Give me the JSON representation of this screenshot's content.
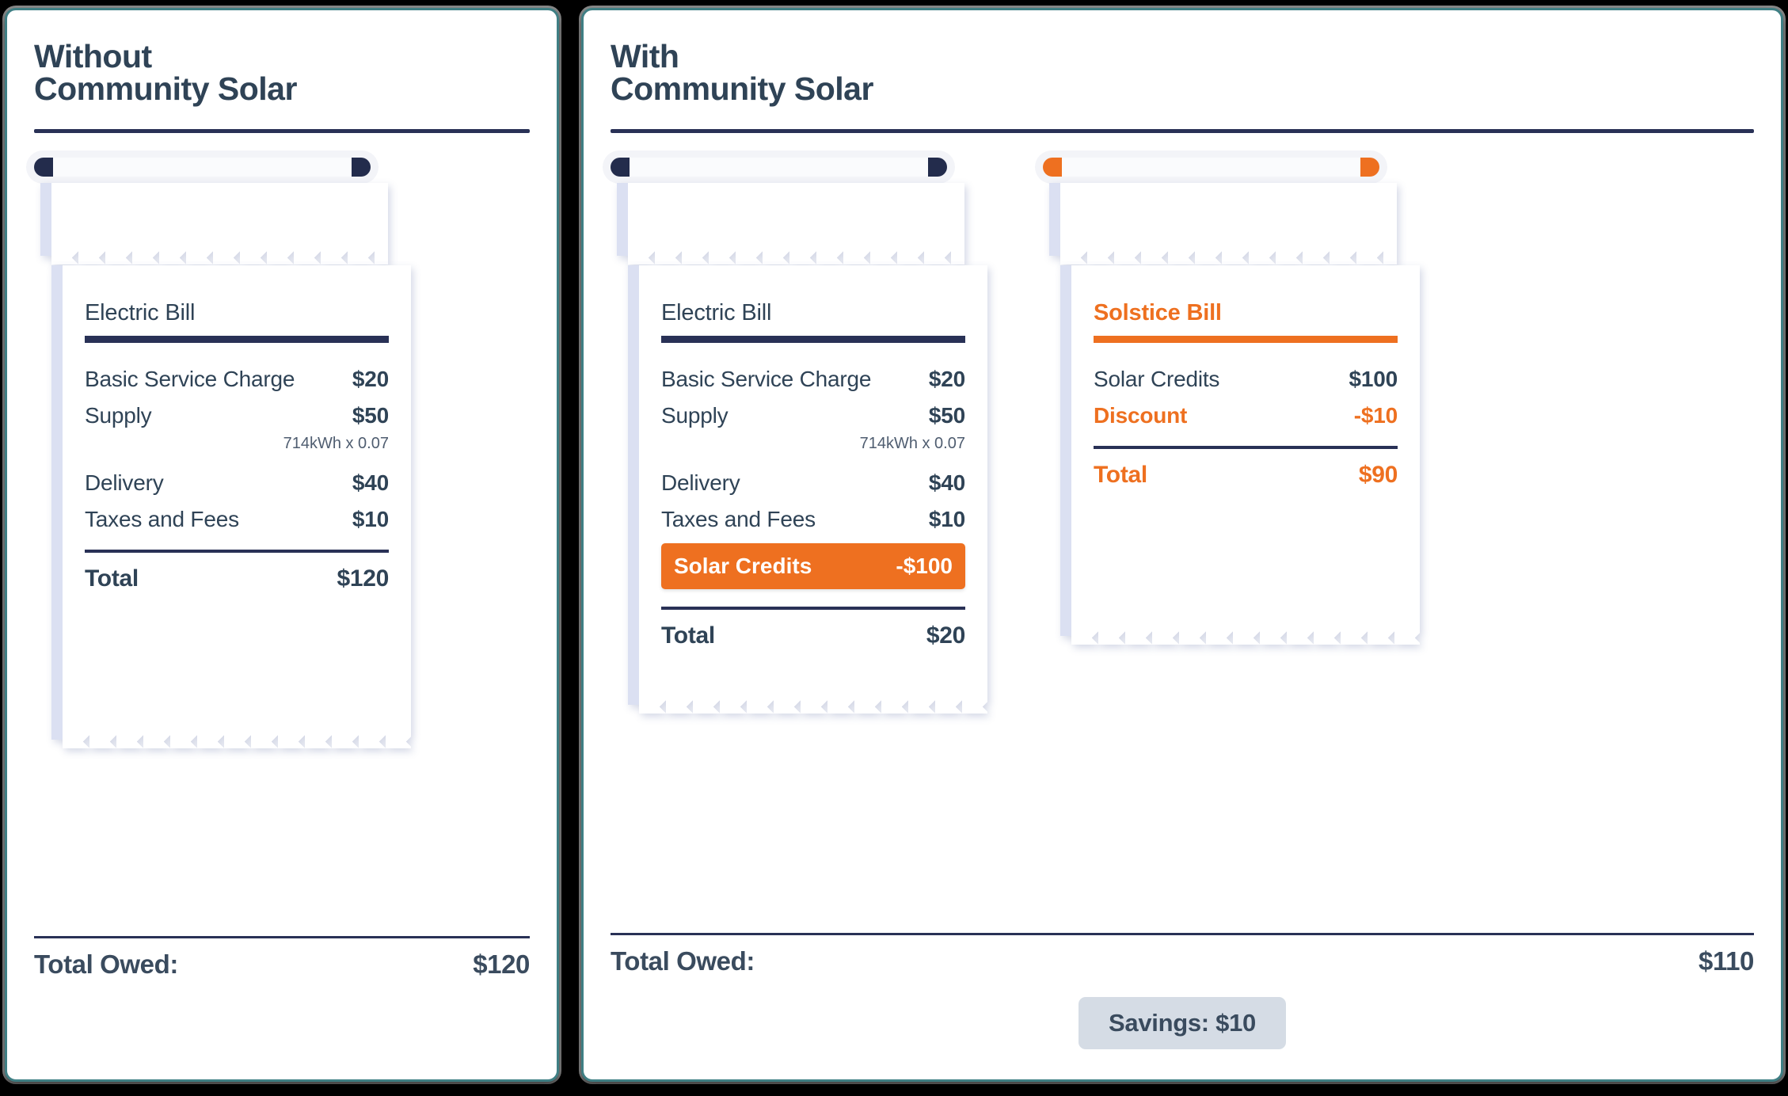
{
  "left_panel": {
    "title": "Without\nCommunity Solar",
    "receipt": {
      "hanger": {
        "tab_color": "#232c4c"
      },
      "bill_name": "Electric Bill",
      "lines": [
        {
          "label": "Basic Service Charge",
          "amount": "$20"
        },
        {
          "label": "Supply",
          "amount": "$50",
          "sub": "714kWh x 0.07"
        },
        {
          "label": "Delivery",
          "amount": "$40"
        },
        {
          "label": "Taxes and Fees",
          "amount": "$10"
        }
      ],
      "total_label": "Total",
      "total_amount": "$120"
    },
    "footer": {
      "owed_label": "Total Owed:",
      "owed_amount": "$120"
    }
  },
  "right_panel": {
    "title": "With\nCommunity Solar",
    "receipts": [
      {
        "hanger": {
          "tab_color": "#232c4c"
        },
        "bill_name": "Electric Bill",
        "bill_name_color": "#2f4356",
        "rule_color": "#293156",
        "lines": [
          {
            "label": "Basic Service Charge",
            "amount": "$20"
          },
          {
            "label": "Supply",
            "amount": "$50",
            "sub": "714kWh x 0.07"
          },
          {
            "label": "Delivery",
            "amount": "$40"
          },
          {
            "label": "Taxes and Fees",
            "amount": "$10"
          }
        ],
        "highlight": {
          "label": "Solar Credits",
          "amount": "-$100"
        },
        "total_label": "Total",
        "total_amount": "$20"
      },
      {
        "hanger": {
          "tab_color": "#ee7020"
        },
        "bill_name": "Solstice Bill",
        "bill_name_color": "#ee7020",
        "rule_color": "#ee7020",
        "lines": [
          {
            "label": "Solar Credits",
            "amount": "$100"
          },
          {
            "label": "Discount",
            "amount": "-$10",
            "orange": true
          }
        ],
        "total_label": "Total",
        "total_amount": "$90"
      }
    ],
    "footer": {
      "owed_label": "Total Owed:",
      "owed_amount": "$110",
      "savings_badge": "Savings: $10"
    }
  },
  "colors": {
    "accent_orange": "#ee7020",
    "navy": "#293156",
    "text_slate": "#2f4356",
    "paper_edge": "#dbe0f2",
    "badge_bg": "#d5dce5",
    "panel_border": "#3f7f84"
  }
}
